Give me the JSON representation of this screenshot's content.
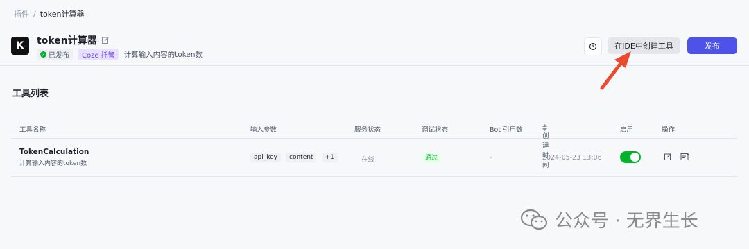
{
  "breadcrumb": {
    "root": "插件",
    "sep": "/",
    "current": "token计算器"
  },
  "header": {
    "logo_text": "K",
    "title": "token计算器",
    "status": "已发布",
    "hosting": "Coze 托管",
    "description": "计算输入内容的token数",
    "ide_button": "在IDE中创建工具",
    "publish_button": "发布"
  },
  "section_title": "工具列表",
  "table": {
    "headers": {
      "name": "工具名称",
      "params": "输入参数",
      "service": "服务状态",
      "debug": "调试状态",
      "bot": "Bot 引用数",
      "created": "创建时间",
      "enable": "启用",
      "ops": "操作"
    },
    "rows": [
      {
        "name": "TokenCalculation",
        "desc": "计算输入内容的token数",
        "params": [
          "api_key",
          "content",
          "+1"
        ],
        "service": "在线",
        "debug": "通过",
        "bot": "-",
        "created": "2024-05-23 13:06",
        "enabled": true
      }
    ]
  },
  "watermark": "公众号 · 无界生长",
  "colors": {
    "primary": "#4d53e8",
    "success": "#00b42a",
    "coze": "#6b44e6",
    "arrow": "#ea4a2e"
  }
}
